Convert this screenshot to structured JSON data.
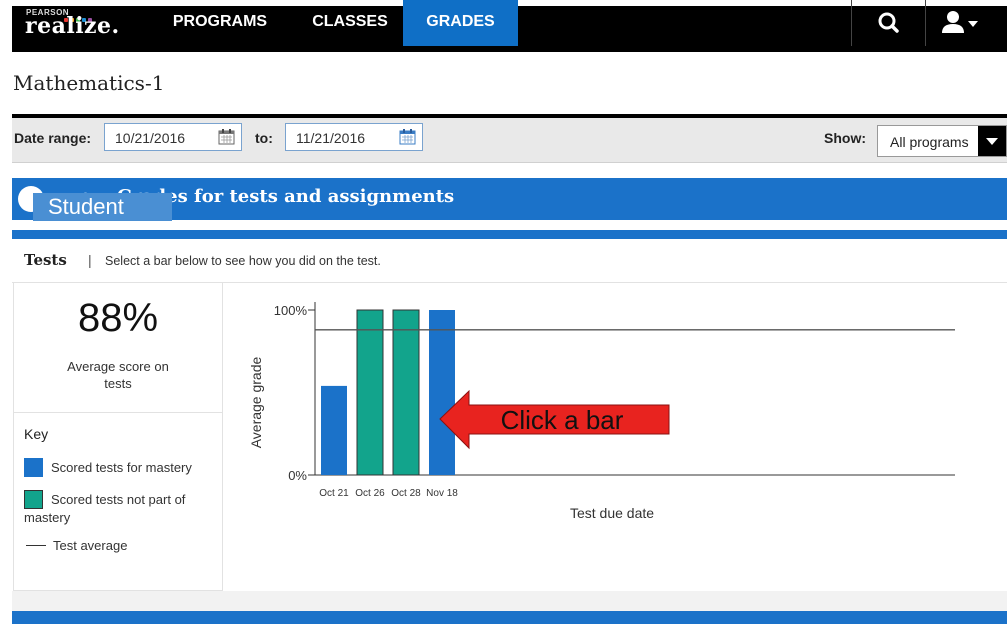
{
  "nav": {
    "logo_small": "PEARSON",
    "logo": "realize.",
    "tabs": [
      "PROGRAMS",
      "CLASSES",
      "GRADES"
    ],
    "active_tab": "GRADES",
    "icons": [
      "search-icon",
      "user-menu-icon"
    ]
  },
  "page": {
    "title": "Mathematics-1"
  },
  "filters": {
    "date_range_label": "Date range:",
    "start_date": "10/21/2016",
    "to_label": "to:",
    "end_date": "11/21/2016",
    "show_label": "Show:",
    "show_value": "All programs"
  },
  "banner": {
    "title": "ury - Grades for tests and assignments",
    "overlay_tag": "Student"
  },
  "tests": {
    "title": "Tests",
    "separator": "|",
    "instruction": "Select a bar below to see how you did on the test."
  },
  "summary": {
    "average": "88%",
    "average_label": "Average score on tests"
  },
  "key": {
    "title": "Key",
    "item1": "Scored tests for mastery",
    "item2_line1": "Scored tests not part of",
    "item2_line2": "mastery",
    "item3": "Test average"
  },
  "colors": {
    "mastery": "#1b72c9",
    "not_mastery": "#12a48c",
    "nav_active": "#0f6fc6",
    "callout": "#e8231f"
  },
  "chart_data": {
    "type": "bar",
    "categories": [
      "Oct 21",
      "Oct 26",
      "Oct 28",
      "Nov 18"
    ],
    "values": [
      54,
      100,
      100,
      100
    ],
    "bar_types": [
      "mastery",
      "not_mastery",
      "not_mastery",
      "mastery"
    ],
    "average_line": 88,
    "ylim": [
      0,
      100
    ],
    "y_ticks": [
      "0%",
      "100%"
    ],
    "xlabel": "Test due date",
    "ylabel": "Average grade",
    "callout": "Click a bar"
  }
}
